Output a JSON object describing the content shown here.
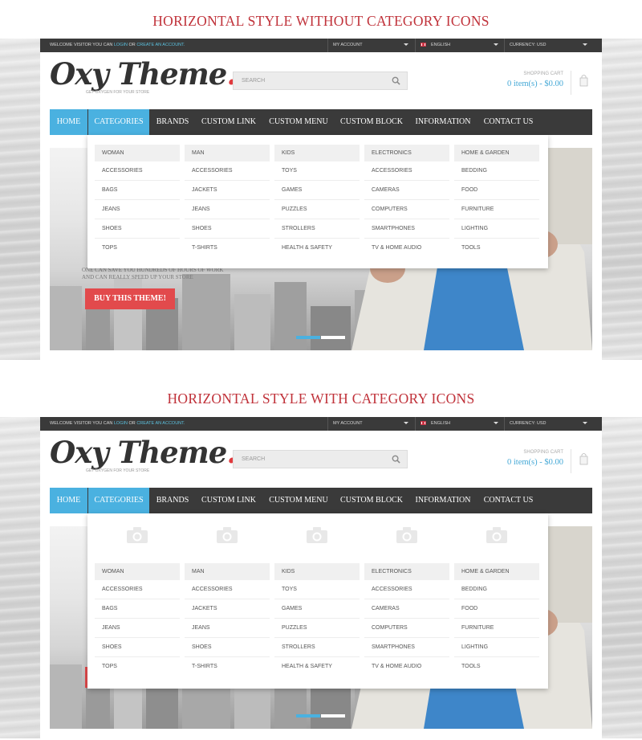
{
  "sections": [
    {
      "heading": "HORIZONTAL STYLE WITHOUT CATEGORY ICONS"
    },
    {
      "heading": "HORIZONTAL STYLE WITH CATEGORY ICONS"
    }
  ],
  "topbar": {
    "welcome_prefix": "WELCOME VISITOR YOU CAN",
    "login": "LOGIN",
    "or": "OR",
    "create_account": "CREATE AN ACCOUNT.",
    "my_account": "MY ACCOUNT",
    "language": "ENGLISH",
    "currency": "CURRENCY: USD"
  },
  "logo": {
    "text": "Oxy Theme",
    "dot": ".",
    "tagline": "GET OXYGEN FOR YOUR STORE"
  },
  "search": {
    "placeholder": "SEARCH"
  },
  "cart": {
    "label": "SHOPPING CART",
    "value": "0 item(s) - $0.00"
  },
  "nav": {
    "items": [
      "HOME",
      "CATEGORIES",
      "BRANDS",
      "CUSTOM LINK",
      "CUSTOM MENU",
      "CUSTOM BLOCK",
      "INFORMATION",
      "CONTACT US"
    ],
    "active": "CATEGORIES"
  },
  "hero": {
    "tagline_line1": "ONE CAN SAVE YOU HUNDREDS OF HOURS OF WORK",
    "tagline_line2": "AND CAN REALLY SPEED UP YOUR STORE",
    "button": "BUY THIS THEME!"
  },
  "mega": {
    "columns": [
      {
        "head": "WOMAN",
        "items": [
          "ACCESSORIES",
          "BAGS",
          "JEANS",
          "SHOES",
          "TOPS"
        ]
      },
      {
        "head": "MAN",
        "items": [
          "ACCESSORIES",
          "JACKETS",
          "JEANS",
          "SHOES",
          "T-SHIRTS"
        ]
      },
      {
        "head": "KIDS",
        "items": [
          "TOYS",
          "GAMES",
          "PUZZLES",
          "STROLLERS",
          "HEALTH & SAFETY"
        ]
      },
      {
        "head": "ELECTRONICS",
        "items": [
          "ACCESSORIES",
          "CAMERAS",
          "COMPUTERS",
          "SMARTPHONES",
          "TV & HOME AUDIO"
        ]
      },
      {
        "head": "HOME & GARDEN",
        "items": [
          "BEDDING",
          "FOOD",
          "FURNITURE",
          "LIGHTING",
          "TOOLS"
        ]
      }
    ],
    "icon": "camera-icon"
  },
  "colors": {
    "accent": "#4ab1e0",
    "heading": "#c0323a",
    "button": "#e24a4c",
    "nav_bg": "#3a3a3a"
  }
}
